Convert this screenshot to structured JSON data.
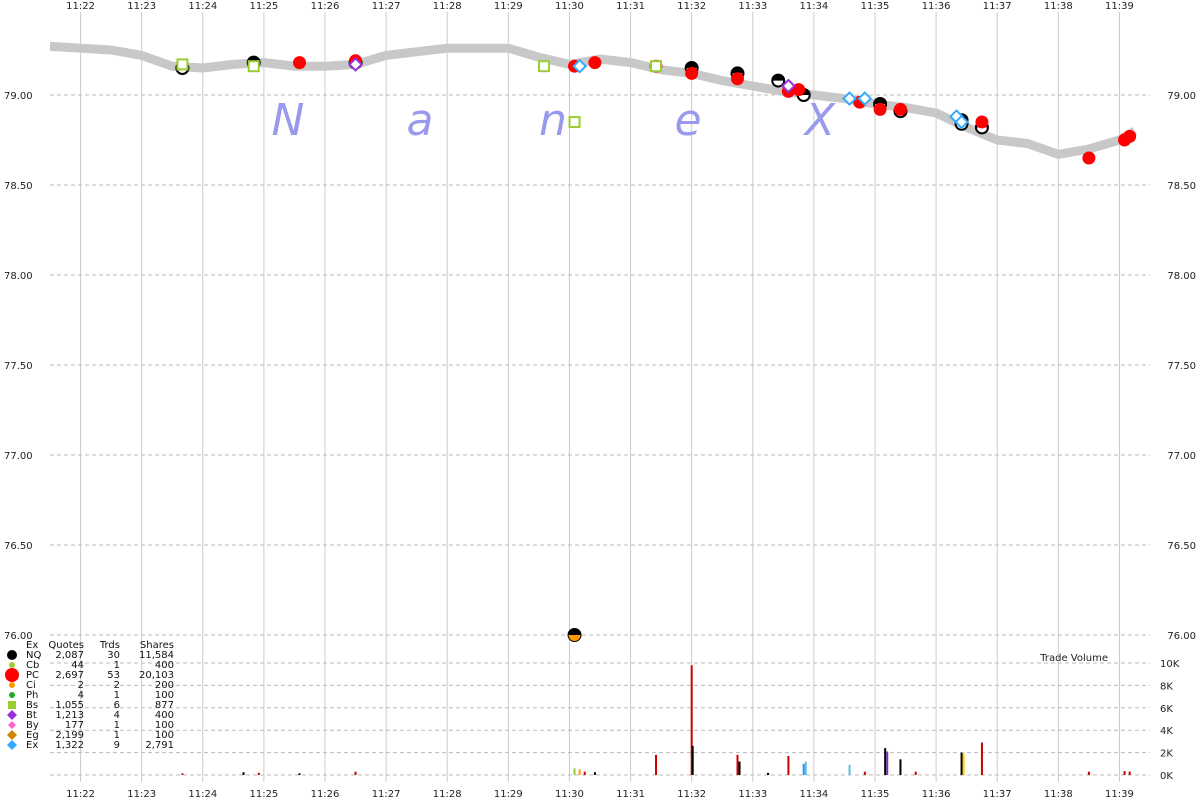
{
  "chart_data": [
    {
      "type": "scatter",
      "subtype": "price-time trades and NBBO band",
      "title": "",
      "watermark": "N a n e X",
      "xlabel": "",
      "ylabel": "",
      "x_ticks": [
        "11:22",
        "11:23",
        "11:24",
        "11:25",
        "11:26",
        "11:27",
        "11:28",
        "11:29",
        "11:30",
        "11:31",
        "11:32",
        "11:33",
        "11:34",
        "11:35",
        "11:36",
        "11:37",
        "11:38",
        "11:39"
      ],
      "y_ticks": [
        "79.00",
        "78.50",
        "78.00",
        "77.50",
        "77.00",
        "76.50",
        "76.00"
      ],
      "xlim": [
        "11:21:30",
        "11:39:30"
      ],
      "ylim": [
        75.95,
        79.25
      ],
      "grid": true,
      "nbbo_band": [
        {
          "t": "11:21:30",
          "y": 79.27
        },
        {
          "t": "11:22:30",
          "y": 79.25
        },
        {
          "t": "11:23:00",
          "y": 79.22
        },
        {
          "t": "11:23:30",
          "y": 79.16
        },
        {
          "t": "11:24:00",
          "y": 79.15
        },
        {
          "t": "11:24:30",
          "y": 79.17
        },
        {
          "t": "11:25:00",
          "y": 79.18
        },
        {
          "t": "11:25:30",
          "y": 79.16
        },
        {
          "t": "11:26:00",
          "y": 79.16
        },
        {
          "t": "11:26:30",
          "y": 79.17
        },
        {
          "t": "11:27:00",
          "y": 79.22
        },
        {
          "t": "11:28:00",
          "y": 79.26
        },
        {
          "t": "11:29:00",
          "y": 79.26
        },
        {
          "t": "11:29:30",
          "y": 79.21
        },
        {
          "t": "11:30:00",
          "y": 79.17
        },
        {
          "t": "11:30:30",
          "y": 79.2
        },
        {
          "t": "11:31:00",
          "y": 79.18
        },
        {
          "t": "11:31:30",
          "y": 79.14
        },
        {
          "t": "11:32:00",
          "y": 79.12
        },
        {
          "t": "11:32:30",
          "y": 79.08
        },
        {
          "t": "11:33:00",
          "y": 79.05
        },
        {
          "t": "11:33:30",
          "y": 79.02
        },
        {
          "t": "11:34:00",
          "y": 79.0
        },
        {
          "t": "11:34:30",
          "y": 78.98
        },
        {
          "t": "11:35:00",
          "y": 78.95
        },
        {
          "t": "11:35:30",
          "y": 78.93
        },
        {
          "t": "11:36:00",
          "y": 78.9
        },
        {
          "t": "11:36:30",
          "y": 78.82
        },
        {
          "t": "11:37:00",
          "y": 78.75
        },
        {
          "t": "11:37:30",
          "y": 78.73
        },
        {
          "t": "11:38:00",
          "y": 78.67
        },
        {
          "t": "11:38:30",
          "y": 78.7
        },
        {
          "t": "11:39:00",
          "y": 78.75
        },
        {
          "t": "11:39:15",
          "y": 78.8
        }
      ],
      "series": [
        {
          "name": "NQ",
          "points": [
            {
              "t": "11:23:40",
              "y": 79.15
            },
            {
              "t": "11:24:50",
              "y": 79.18
            },
            {
              "t": "11:26:30",
              "y": 79.18
            },
            {
              "t": "11:32:00",
              "y": 79.15
            },
            {
              "t": "11:32:45",
              "y": 79.12
            },
            {
              "t": "11:33:25",
              "y": 79.08
            },
            {
              "t": "11:33:50",
              "y": 79.0
            },
            {
              "t": "11:35:05",
              "y": 78.95
            },
            {
              "t": "11:35:25",
              "y": 78.91
            },
            {
              "t": "11:36:25",
              "y": 78.86
            },
            {
              "t": "11:36:25",
              "y": 78.84
            },
            {
              "t": "11:36:45",
              "y": 78.82
            },
            {
              "t": "11:30:05",
              "y": 76.0
            }
          ]
        },
        {
          "name": "PC",
          "points": [
            {
              "t": "11:25:35",
              "y": 79.18
            },
            {
              "t": "11:26:30",
              "y": 79.19
            },
            {
              "t": "11:30:05",
              "y": 79.16
            },
            {
              "t": "11:30:25",
              "y": 79.18
            },
            {
              "t": "11:31:25",
              "y": 79.16
            },
            {
              "t": "11:32:00",
              "y": 79.12
            },
            {
              "t": "11:32:45",
              "y": 79.09
            },
            {
              "t": "11:33:35",
              "y": 79.02
            },
            {
              "t": "11:33:45",
              "y": 79.03
            },
            {
              "t": "11:34:45",
              "y": 78.96
            },
            {
              "t": "11:35:05",
              "y": 78.92
            },
            {
              "t": "11:35:25",
              "y": 78.92
            },
            {
              "t": "11:36:45",
              "y": 78.85
            },
            {
              "t": "11:38:30",
              "y": 78.65
            },
            {
              "t": "11:39:05",
              "y": 78.75
            },
            {
              "t": "11:39:10",
              "y": 78.77
            }
          ]
        },
        {
          "name": "Bs",
          "points": [
            {
              "t": "11:23:40",
              "y": 79.17
            },
            {
              "t": "11:24:50",
              "y": 79.16
            },
            {
              "t": "11:29:35",
              "y": 79.16
            },
            {
              "t": "11:30:05",
              "y": 78.85
            },
            {
              "t": "11:31:25",
              "y": 79.16
            }
          ]
        },
        {
          "name": "Bt",
          "points": [
            {
              "t": "11:26:30",
              "y": 79.17
            },
            {
              "t": "11:33:35",
              "y": 79.05
            }
          ]
        },
        {
          "name": "Ex",
          "points": [
            {
              "t": "11:30:10",
              "y": 79.16
            },
            {
              "t": "11:34:35",
              "y": 78.98
            },
            {
              "t": "11:34:50",
              "y": 78.98
            },
            {
              "t": "11:36:20",
              "y": 78.88
            },
            {
              "t": "11:36:25",
              "y": 78.85
            }
          ]
        },
        {
          "name": "Ci",
          "points": [
            {
              "t": "11:30:05",
              "y": 76.0
            }
          ]
        }
      ]
    },
    {
      "type": "bar",
      "title": "Trade Volume",
      "ylabel": "",
      "y_ticks": [
        "10K",
        "8K",
        "6K",
        "4K",
        "2K",
        "0K"
      ],
      "ylim": [
        0,
        10000
      ],
      "bars": [
        {
          "t": "11:23:40",
          "v": 150,
          "color": "#cc0000"
        },
        {
          "t": "11:24:40",
          "v": 250,
          "color": "#000000"
        },
        {
          "t": "11:24:55",
          "v": 200,
          "color": "#cc0000"
        },
        {
          "t": "11:25:35",
          "v": 150,
          "color": "#000000"
        },
        {
          "t": "11:26:30",
          "v": 300,
          "color": "#cc0000"
        },
        {
          "t": "11:30:05",
          "v": 600,
          "color": "#9acd32"
        },
        {
          "t": "11:30:10",
          "v": 500,
          "color": "#ff9900"
        },
        {
          "t": "11:30:15",
          "v": 300,
          "color": "#cc0000"
        },
        {
          "t": "11:30:25",
          "v": 250,
          "color": "#000000"
        },
        {
          "t": "11:31:25",
          "v": 1800,
          "color": "#cc0000"
        },
        {
          "t": "11:32:00",
          "v": 9800,
          "color": "#cc0000"
        },
        {
          "t": "11:32:01",
          "v": 2600,
          "color": "#000000"
        },
        {
          "t": "11:32:45",
          "v": 1800,
          "color": "#cc0000"
        },
        {
          "t": "11:32:47",
          "v": 1200,
          "color": "#000000"
        },
        {
          "t": "11:33:15",
          "v": 200,
          "color": "#000000"
        },
        {
          "t": "11:33:35",
          "v": 1700,
          "color": "#cc0000"
        },
        {
          "t": "11:33:50",
          "v": 1000,
          "color": "#1e90ff"
        },
        {
          "t": "11:33:52",
          "v": 1200,
          "color": "#5bc0de"
        },
        {
          "t": "11:34:35",
          "v": 900,
          "color": "#5bc0de"
        },
        {
          "t": "11:34:50",
          "v": 300,
          "color": "#cc0000"
        },
        {
          "t": "11:35:10",
          "v": 2400,
          "color": "#000000"
        },
        {
          "t": "11:35:12",
          "v": 2100,
          "color": "#7b2fbe"
        },
        {
          "t": "11:35:25",
          "v": 1400,
          "color": "#000000"
        },
        {
          "t": "11:35:40",
          "v": 300,
          "color": "#cc0000"
        },
        {
          "t": "11:36:25",
          "v": 2000,
          "color": "#000000"
        },
        {
          "t": "11:36:27",
          "v": 1900,
          "color": "#ffcc00"
        },
        {
          "t": "11:36:45",
          "v": 2900,
          "color": "#cc0000"
        },
        {
          "t": "11:38:30",
          "v": 300,
          "color": "#cc0000"
        },
        {
          "t": "11:39:05",
          "v": 350,
          "color": "#cc0000"
        },
        {
          "t": "11:39:10",
          "v": 300,
          "color": "#cc0000"
        }
      ]
    }
  ],
  "legend": {
    "headers": [
      "Ex",
      "Quotes",
      "Trds",
      "Shares"
    ],
    "rows": [
      {
        "ex": "NQ",
        "quotes": "2,087",
        "trds": "30",
        "shares": "11,584",
        "color": "#000000",
        "shape": "circle",
        "size": 5
      },
      {
        "ex": "Cb",
        "quotes": "44",
        "trds": "1",
        "shares": "400",
        "color": "#9acd32",
        "shape": "circle",
        "size": 3
      },
      {
        "ex": "PC",
        "quotes": "2,697",
        "trds": "53",
        "shares": "20,103",
        "color": "#ff0000",
        "shape": "circle",
        "size": 7
      },
      {
        "ex": "Ci",
        "quotes": "2",
        "trds": "2",
        "shares": "200",
        "color": "#ff9900",
        "shape": "circle",
        "size": 3
      },
      {
        "ex": "Ph",
        "quotes": "4",
        "trds": "1",
        "shares": "100",
        "color": "#22aa22",
        "shape": "circle",
        "size": 3
      },
      {
        "ex": "Bs",
        "quotes": "1,055",
        "trds": "6",
        "shares": "877",
        "color": "#9acd32",
        "shape": "square",
        "size": 4
      },
      {
        "ex": "Bt",
        "quotes": "1,213",
        "trds": "4",
        "shares": "400",
        "color": "#9b30d9",
        "shape": "diamond",
        "size": 5
      },
      {
        "ex": "By",
        "quotes": "177",
        "trds": "1",
        "shares": "100",
        "color": "#ff66cc",
        "shape": "diamond",
        "size": 4
      },
      {
        "ex": "Eg",
        "quotes": "2,199",
        "trds": "1",
        "shares": "100",
        "color": "#cc8800",
        "shape": "diamond",
        "size": 5
      },
      {
        "ex": "Ex",
        "quotes": "1,322",
        "trds": "9",
        "shares": "2,791",
        "color": "#33aaff",
        "shape": "diamond",
        "size": 5
      }
    ]
  },
  "colors": {
    "nbbo_band": "#c8c8c8",
    "grid_v": "#cccccc",
    "grid_h": "#bbbbbb",
    "watermark": "#9999ee",
    "NQ": "#000000",
    "PC": "#ff0000",
    "Bs": "#9acd32",
    "Bt": "#9b30d9",
    "Ex": "#33aaff",
    "Ci": "#ff9900"
  }
}
